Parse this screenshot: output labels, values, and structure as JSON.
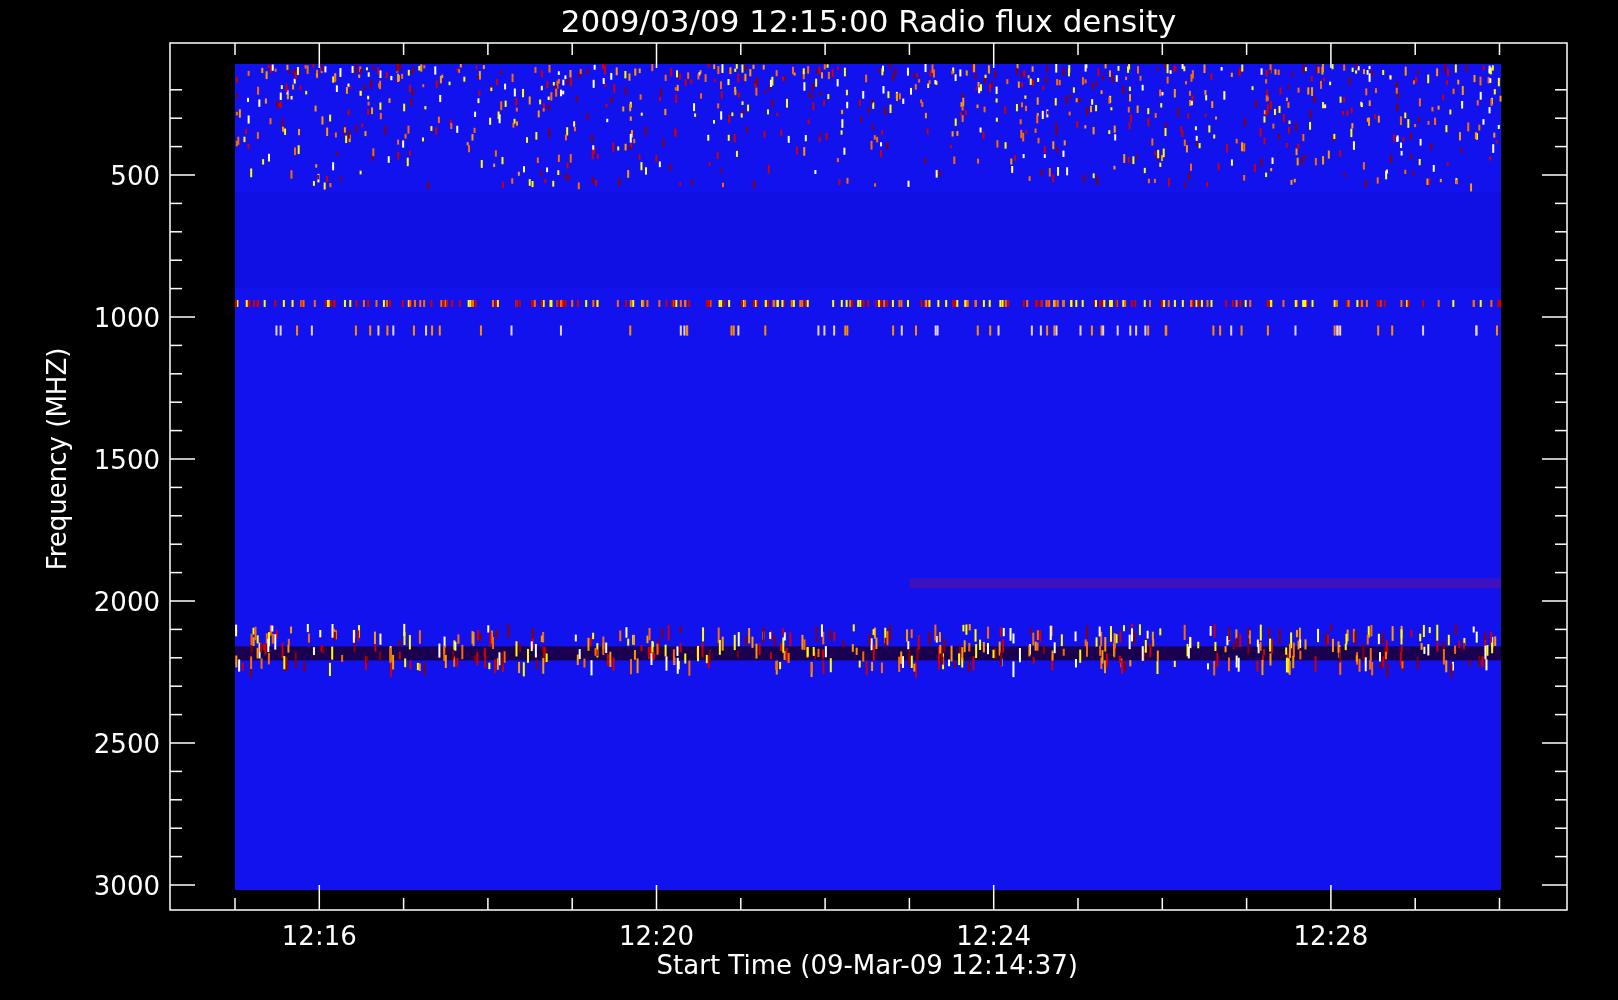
{
  "title": "2009/03/09 12:15:00 Radio flux density",
  "y_axis": {
    "label": "Frequency (MHZ)",
    "ticks": [
      "500",
      "1000",
      "1500",
      "2000",
      "2500",
      "3000"
    ]
  },
  "x_axis": {
    "label": "Start Time (09-Mar-09 12:14:37)",
    "ticks": [
      "12:16",
      "12:20",
      "12:24",
      "12:28"
    ]
  }
}
